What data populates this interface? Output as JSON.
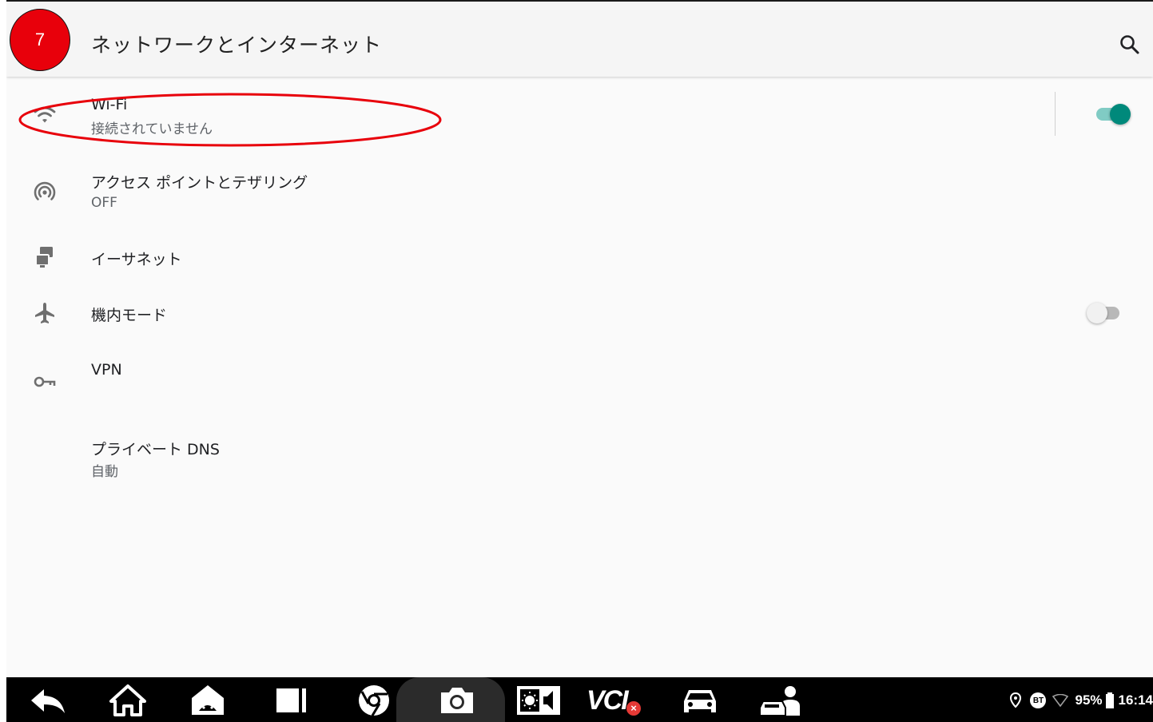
{
  "annotation": {
    "step_number": "7",
    "badge_color": "#e8000b",
    "outline_color": "#e8000b"
  },
  "appbar": {
    "title": "ネットワークとインターネット",
    "search_icon": "search-icon"
  },
  "settings": {
    "wifi": {
      "title": "Wi-Fi",
      "summary": "接続されていません",
      "icon": "wifi-icon",
      "enabled": true
    },
    "hotspot": {
      "title": "アクセス ポイントとテザリング",
      "summary": "OFF",
      "icon": "hotspot-icon"
    },
    "ethernet": {
      "title": "イーサネット",
      "icon": "ethernet-icon"
    },
    "airplane": {
      "title": "機内モード",
      "icon": "airplane-icon",
      "enabled": false
    },
    "vpn": {
      "title": "VPN",
      "icon": "vpn-key-icon"
    },
    "private_dns": {
      "title": "プライベート DNS",
      "summary": "自動"
    }
  },
  "navbar": {
    "vci_label": "VCI",
    "items": [
      "back-icon",
      "home-icon",
      "android-home-icon",
      "recents-icon",
      "browser-icon",
      "camera-icon",
      "brightness-volume-icon",
      "vci-icon",
      "car-icon",
      "remote-expert-icon"
    ]
  },
  "status_bar": {
    "battery": "95%",
    "time": "16:14",
    "bt_label": "BT"
  },
  "colors": {
    "accent": "#00897b",
    "accent_track": "#80cbc4",
    "background": "#fafafa",
    "navbar": "#000000"
  }
}
